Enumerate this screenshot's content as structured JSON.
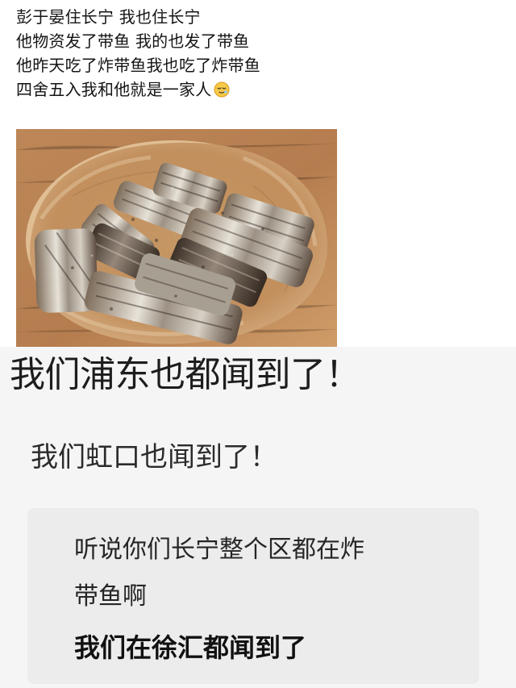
{
  "post": {
    "lines": [
      "彭于晏住长宁 我也住长宁",
      "他物资发了带鱼 我的也发了带鱼",
      "他昨天吃了炸带鱼我也吃了炸带鱼",
      "四舍五入我和他就是一家人"
    ],
    "emoji_icon": "sleepy-face-icon"
  },
  "photo": {
    "icon": "fried-hairtail-photo",
    "colors": {
      "table": "#b98456",
      "paper": "#c7945f",
      "fish_light": "#d8d5cc",
      "fish_dark": "#5b4c3f"
    }
  },
  "replies": {
    "pudong": "我们浦东也都闻到了！",
    "hongkou": "我们虹口也闻到了！",
    "changning_line_1": "听说你们长宁整个区都在炸",
    "changning_line_2": "带鱼啊",
    "xuhui": "我们在徐汇都闻到了"
  },
  "colors": {
    "background": "#ffffff",
    "reply_background": "#f5f5f5",
    "card_background": "#ececec",
    "text": "#111111"
  }
}
